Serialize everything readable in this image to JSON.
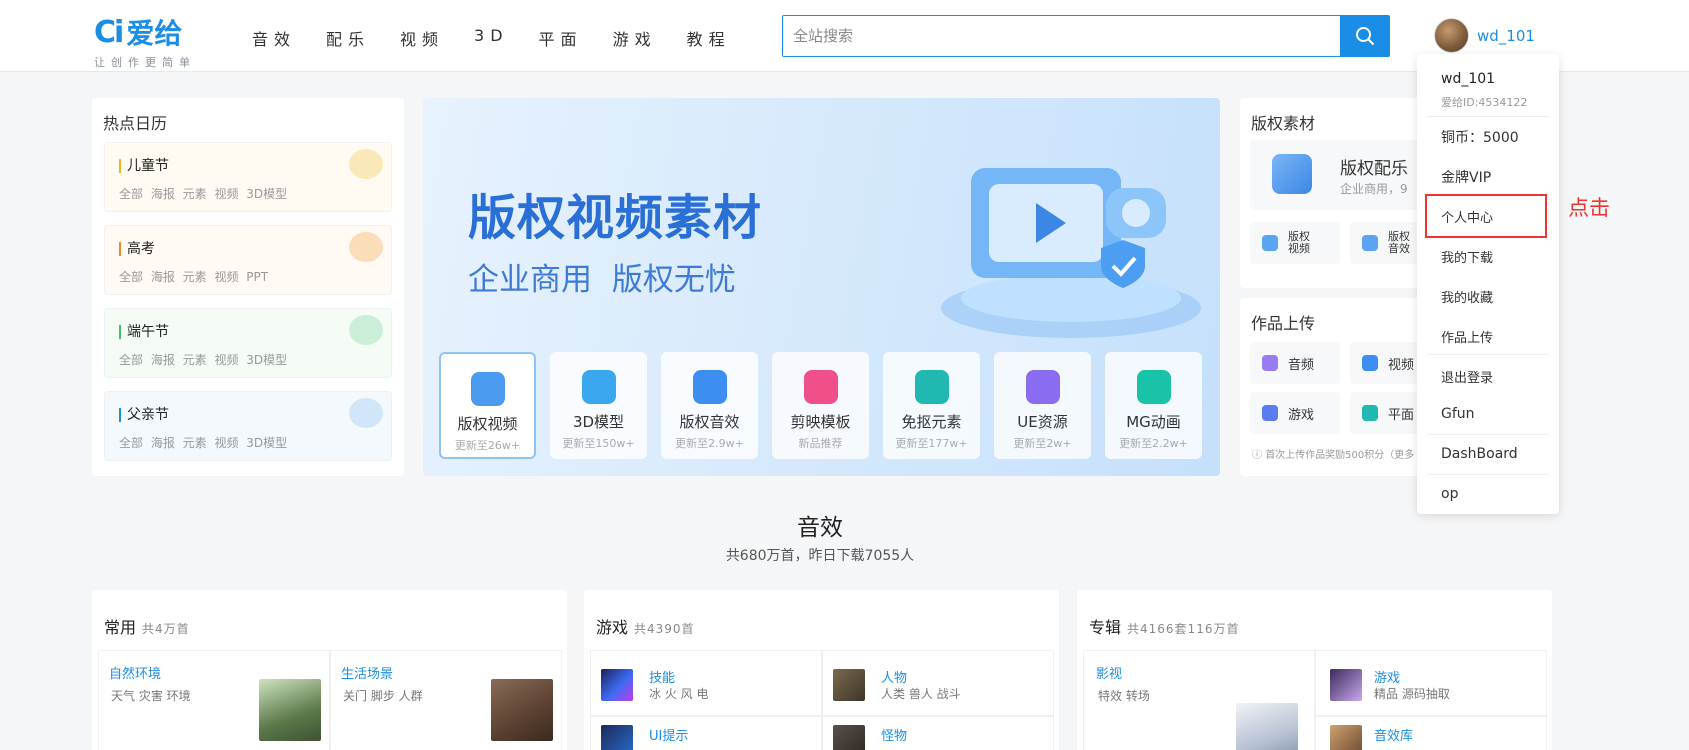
{
  "header": {
    "logo_mark": "Ci",
    "logo_name": "爱给",
    "slogan": "让创作更简单",
    "nav": [
      "音效",
      "配乐",
      "视频",
      "3D",
      "平面",
      "游戏",
      "教程"
    ],
    "search_placeholder": "全站搜索",
    "username": "wd_101"
  },
  "hot_calendar": {
    "title": "热点日历",
    "items": [
      {
        "name": "儿童节",
        "tags": "全部 海报 元素 视频 3D模型",
        "accent": "#f2b31b"
      },
      {
        "name": "高考",
        "tags": "全部 海报 元素 视频 PPT",
        "accent": "#f08a24"
      },
      {
        "name": "端午节",
        "tags": "全部 海报 元素 视频 3D模型",
        "accent": "#3fbf6a"
      },
      {
        "name": "父亲节",
        "tags": "全部 海报 元素 视频 3D模型",
        "accent": "#1a8de6"
      }
    ]
  },
  "banner": {
    "title": "版权视频素材",
    "subtitle": "企业商用 版权无忧",
    "categories": [
      {
        "title": "版权视频",
        "sub": "更新至26w+",
        "color": "#4a9af0"
      },
      {
        "title": "3D模型",
        "sub": "更新至150w+",
        "color": "#39a8ee"
      },
      {
        "title": "版权音效",
        "sub": "更新至2.9w+",
        "color": "#3c8ff0"
      },
      {
        "title": "剪映模板",
        "sub": "新品推荐",
        "color": "#f0508a"
      },
      {
        "title": "免抠元素",
        "sub": "更新至177w+",
        "color": "#20b8b0"
      },
      {
        "title": "UE资源",
        "sub": "更新至2w+",
        "color": "#8a6cf0"
      },
      {
        "title": "MG动画",
        "sub": "更新至2.2w+",
        "color": "#19c3a8"
      }
    ]
  },
  "copyright": {
    "title": "版权素材",
    "main_title": "版权配乐",
    "main_sub": "企业商用，9",
    "minis": [
      "版权视频",
      "版权音效"
    ]
  },
  "upload": {
    "title": "作品上传",
    "items": [
      "音频",
      "视频",
      "游戏",
      "平面"
    ],
    "note": "首次上传作品奖励500积分（更多"
  },
  "section": {
    "title": "音效",
    "subtitle": "共680万首，昨日下载7055人",
    "columns": [
      {
        "title": "常用",
        "count": "共4万首",
        "cells": [
          {
            "name": "自然环境",
            "tags": "天气 灾害 环境"
          },
          {
            "name": "生活场景",
            "tags": "关门 脚步 人群"
          }
        ]
      },
      {
        "title": "游戏",
        "count": "共4390首",
        "cells": [
          {
            "name": "技能",
            "tags": "冰 火 风 电"
          },
          {
            "name": "人物",
            "tags": "人类 兽人 战斗"
          },
          {
            "name": "UI提示",
            "tags": ""
          },
          {
            "name": "怪物",
            "tags": ""
          }
        ]
      },
      {
        "title": "专辑",
        "count": "共4166套116万首",
        "cells": [
          {
            "name": "影视",
            "tags": "特效 转场"
          },
          {
            "name": "游戏",
            "tags": "精品 源码抽取"
          },
          {
            "name": "音效库",
            "tags": ""
          }
        ]
      }
    ]
  },
  "dropdown": {
    "username": "wd_101",
    "user_id": "爱给ID:4534122",
    "items": [
      "铜币：5000",
      "金牌VIP",
      "个人中心",
      "我的下载",
      "我的收藏",
      "作品上传",
      "退出登录",
      "Gfun",
      "DashBoard",
      "op"
    ]
  },
  "annotation": "点击"
}
